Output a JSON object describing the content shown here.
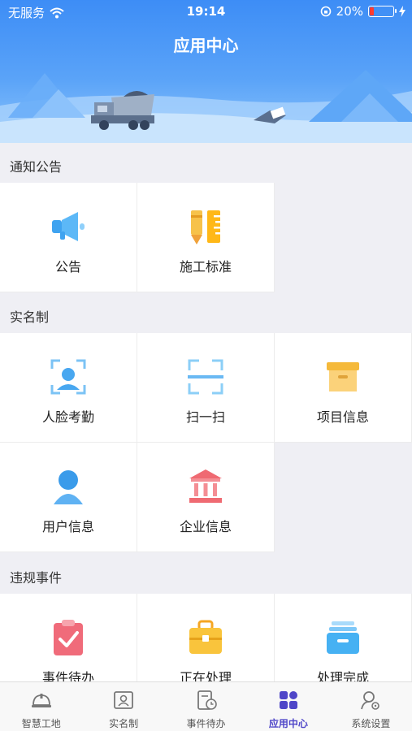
{
  "status_bar": {
    "carrier": "无服务",
    "time": "19:14",
    "battery": "20%",
    "battery_level": 0.2
  },
  "header": {
    "title": "应用中心"
  },
  "sections": [
    {
      "label": "通知公告",
      "items": [
        {
          "label": "公告",
          "icon": "megaphone-icon"
        },
        {
          "label": "施工标准",
          "icon": "pencil-ruler-icon"
        }
      ]
    },
    {
      "label": "实名制",
      "items": [
        {
          "label": "人脸考勤",
          "icon": "face-scan-icon"
        },
        {
          "label": "扫一扫",
          "icon": "scan-icon"
        },
        {
          "label": "项目信息",
          "icon": "archive-box-icon"
        },
        {
          "label": "用户信息",
          "icon": "user-icon"
        },
        {
          "label": "企业信息",
          "icon": "bank-building-icon"
        }
      ]
    },
    {
      "label": "违规事件",
      "items": [
        {
          "label": "事件待办",
          "icon": "clipboard-check-icon"
        },
        {
          "label": "正在处理",
          "icon": "toolbox-icon"
        },
        {
          "label": "处理完成",
          "icon": "inbox-tray-icon"
        }
      ]
    }
  ],
  "tabbar": [
    {
      "label": "智慧工地",
      "icon": "helmet-icon",
      "active": false
    },
    {
      "label": "实名制",
      "icon": "id-card-icon",
      "active": false
    },
    {
      "label": "事件待办",
      "icon": "clock-document-icon",
      "active": false
    },
    {
      "label": "应用中心",
      "icon": "app-grid-icon",
      "active": true
    },
    {
      "label": "系统设置",
      "icon": "user-settings-icon",
      "active": false
    }
  ],
  "colors": {
    "accent": "#4f46c8",
    "header_blue": "#3d8df6"
  }
}
